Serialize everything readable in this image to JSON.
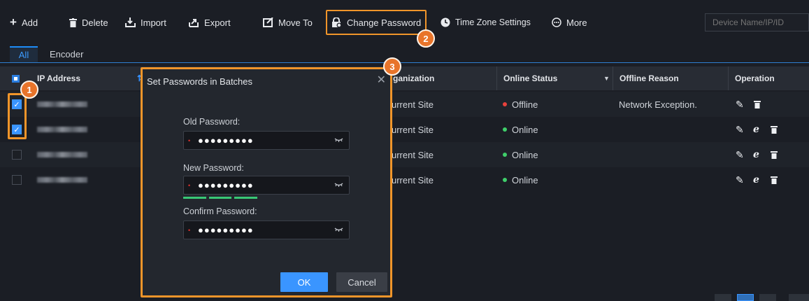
{
  "toolbar": {
    "add": "Add",
    "delete": "Delete",
    "import": "Import",
    "export": "Export",
    "move_to": "Move To",
    "change_password": "Change Password",
    "time_zone": "Time Zone Settings",
    "more": "More",
    "search_placeholder": "Device Name/IP/ID"
  },
  "tabs": [
    "All",
    "Encoder"
  ],
  "table": {
    "headers": {
      "ip": "IP Address",
      "org": "Organization",
      "org_visible": "ganization",
      "status": "Online Status",
      "reason": "Offline Reason",
      "operation": "Operation"
    },
    "rows": [
      {
        "checked": true,
        "org": "urrent Site",
        "status": "Offline",
        "status_color": "#e8413c",
        "reason": "Network Exception."
      },
      {
        "checked": true,
        "org": "urrent Site",
        "status": "Online",
        "status_color": "#3fcf6a",
        "reason": ""
      },
      {
        "checked": false,
        "org": "urrent Site",
        "status": "Online",
        "status_color": "#3fcf6a",
        "reason": ""
      },
      {
        "checked": false,
        "org": "urrent Site",
        "status": "Online",
        "status_color": "#3fcf6a",
        "reason": ""
      }
    ]
  },
  "dialog": {
    "title": "Set Passwords in Batches",
    "old_label": "Old Password:",
    "new_label": "New Password:",
    "confirm_label": "Confirm Password:",
    "masked": "●●●●●●●●●",
    "ok": "OK",
    "cancel": "Cancel",
    "strength_bars_filled": 3
  },
  "callouts": [
    "1",
    "2",
    "3"
  ],
  "colors": {
    "accent": "#3a95ff",
    "highlight": "#f0952a",
    "badge": "#e8742a"
  }
}
